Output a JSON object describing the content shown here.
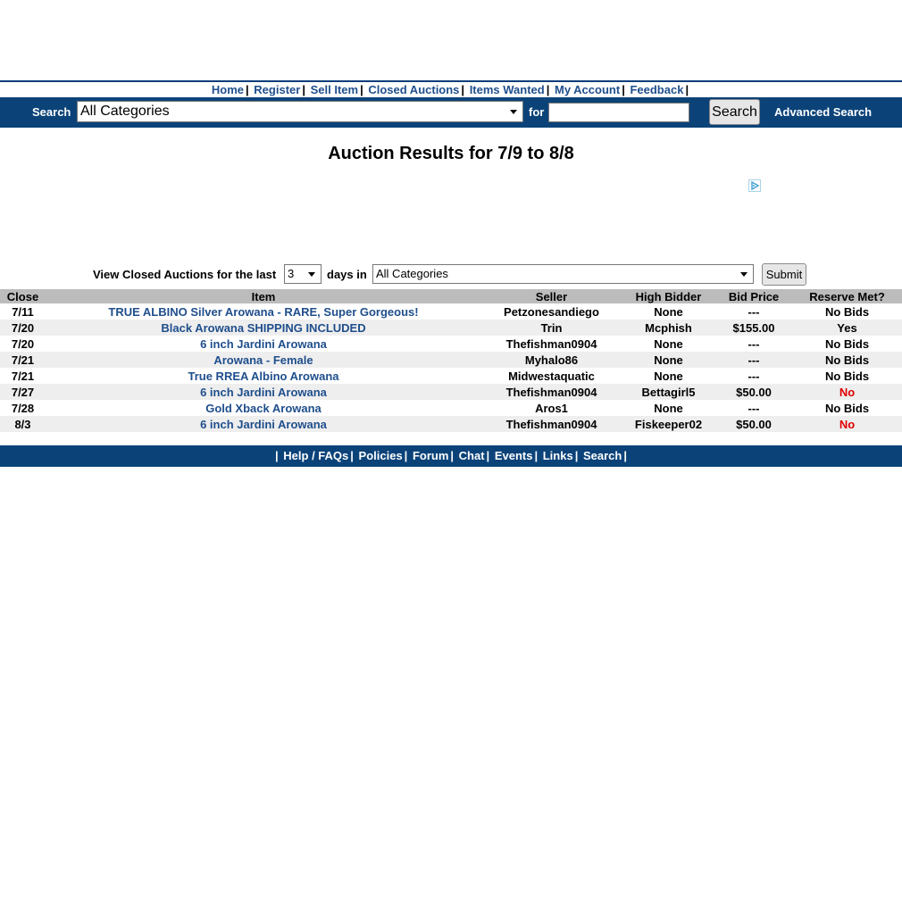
{
  "nav": {
    "links": [
      "Home",
      "Register",
      "Sell Item",
      "Closed Auctions",
      "Items Wanted",
      "My Account",
      "Feedback"
    ]
  },
  "search": {
    "label": "Search",
    "category_value": "All Categories",
    "for_label": "for",
    "query_value": "",
    "button_label": "Search",
    "advanced_label": "Advanced Search"
  },
  "title": "Auction Results for 7/9 to 8/8",
  "filter": {
    "prefix": "View Closed Auctions for the last",
    "days_value": "3",
    "middle": "days in",
    "category_value": "All Categories",
    "submit_label": "Submit"
  },
  "table": {
    "headers": [
      "Close",
      "Item",
      "Seller",
      "High Bidder",
      "Bid Price",
      "Reserve Met?"
    ],
    "rows": [
      {
        "close": "7/11",
        "item": "TRUE ALBINO Silver Arowana - RARE, Super Gorgeous!",
        "seller": "Petzonesandiego",
        "bidder": "None",
        "price": "---",
        "reserve": "No Bids"
      },
      {
        "close": "7/20",
        "item": "Black Arowana SHIPPING INCLUDED",
        "seller": "Trin",
        "bidder": "Mcphish",
        "price": "$155.00",
        "reserve": "Yes"
      },
      {
        "close": "7/20",
        "item": "6 inch Jardini Arowana",
        "seller": "Thefishman0904",
        "bidder": "None",
        "price": "---",
        "reserve": "No Bids"
      },
      {
        "close": "7/21",
        "item": "Arowana - Female",
        "seller": "Myhalo86",
        "bidder": "None",
        "price": "---",
        "reserve": "No Bids"
      },
      {
        "close": "7/21",
        "item": "True RREA Albino Arowana",
        "seller": "Midwestaquatic",
        "bidder": "None",
        "price": "---",
        "reserve": "No Bids"
      },
      {
        "close": "7/27",
        "item": "6 inch Jardini Arowana",
        "seller": "Thefishman0904",
        "bidder": "Bettagirl5",
        "price": "$50.00",
        "reserve": "No"
      },
      {
        "close": "7/28",
        "item": "Gold Xback Arowana",
        "seller": "Aros1",
        "bidder": "None",
        "price": "---",
        "reserve": "No Bids"
      },
      {
        "close": "8/3",
        "item": "6 inch Jardini Arowana",
        "seller": "Thefishman0904",
        "bidder": "Fiskeeper02",
        "price": "$50.00",
        "reserve": "No"
      }
    ]
  },
  "footer": {
    "links": [
      "Help / FAQs",
      "Policies",
      "Forum",
      "Chat",
      "Events",
      "Links",
      "Search"
    ]
  },
  "colors": {
    "brand_blue": "#0b4379",
    "link_blue": "#1f4e8c",
    "reserve_not_met": "#e00000"
  },
  "icons": {
    "ad_choices": "ad-choices-icon"
  }
}
